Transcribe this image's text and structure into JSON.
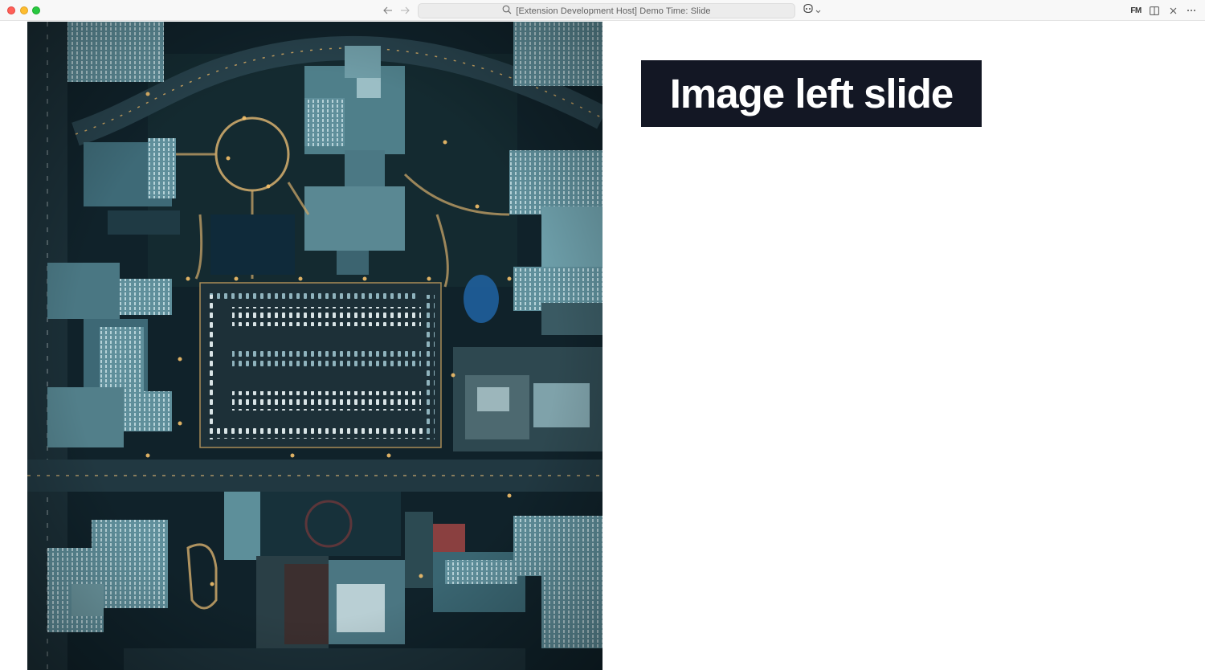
{
  "window": {
    "command_center": {
      "text": "[Extension Development Host] Demo Time: Slide",
      "icon": "search-icon"
    },
    "toolbar_icons": [
      "back-arrow-icon",
      "forward-arrow-icon",
      "copilot-icon",
      "front-matter-icon",
      "split-editor-icon",
      "close-icon",
      "more-icon"
    ],
    "front_matter_label": "FM"
  },
  "slide": {
    "layout": "image-left",
    "title": "Image left slide",
    "image": {
      "description_icon": "aerial-city-photo",
      "dominant_colors": [
        "#0d1c24",
        "#3f7f8c",
        "#e8b766"
      ]
    },
    "title_background": "#131724",
    "title_color": "#ffffff"
  }
}
